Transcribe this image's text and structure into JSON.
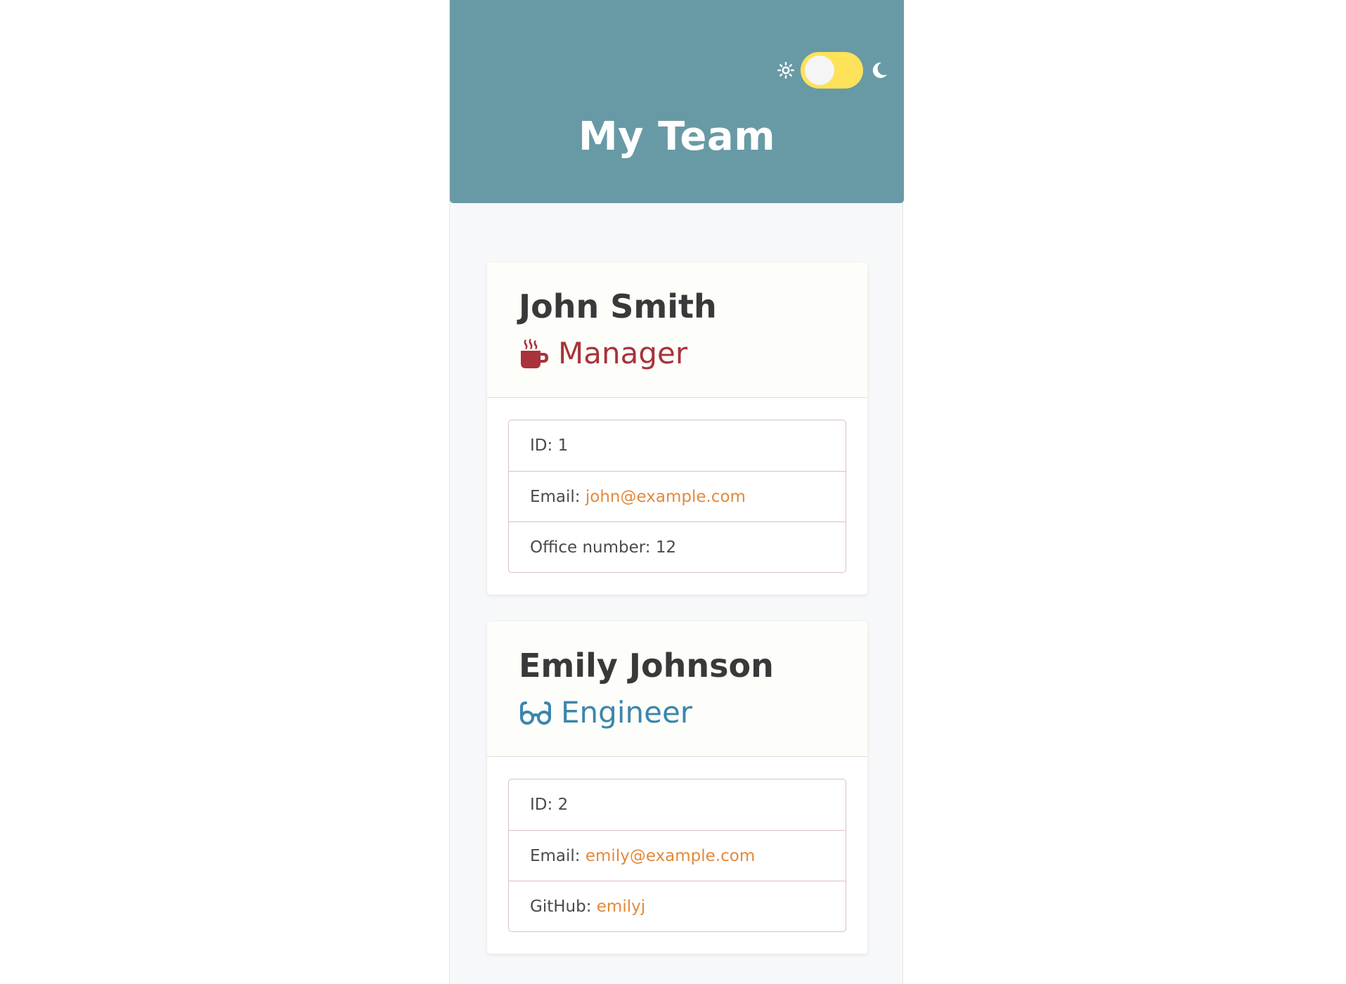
{
  "header": {
    "title": "My Team",
    "theme_toggle": {
      "state": "light",
      "track_color": "#fde25a",
      "icons": [
        "sun-icon",
        "moon-icon"
      ]
    },
    "background": "#689aa5"
  },
  "employees": [
    {
      "name": "John Smith",
      "role": "Manager",
      "role_icon": "coffee-mug-icon",
      "role_color": "#a8333a",
      "details": [
        {
          "label": "ID:",
          "value": "1"
        },
        {
          "label": "Email:",
          "value": "john@example.com"
        },
        {
          "label": "Office number:",
          "value": "12"
        }
      ]
    },
    {
      "name": "Emily Johnson",
      "role": "Engineer",
      "role_icon": "glasses-icon",
      "role_color": "#3b86ad",
      "details": [
        {
          "label": "ID:",
          "value": "2"
        },
        {
          "label": "Email:",
          "value": "emily@example.com"
        },
        {
          "label": "GitHub:",
          "value": "emilyj"
        }
      ]
    }
  ],
  "colors": {
    "link": "#e3893a",
    "text": "#393939",
    "panel_bg": "#f7f8fa"
  }
}
